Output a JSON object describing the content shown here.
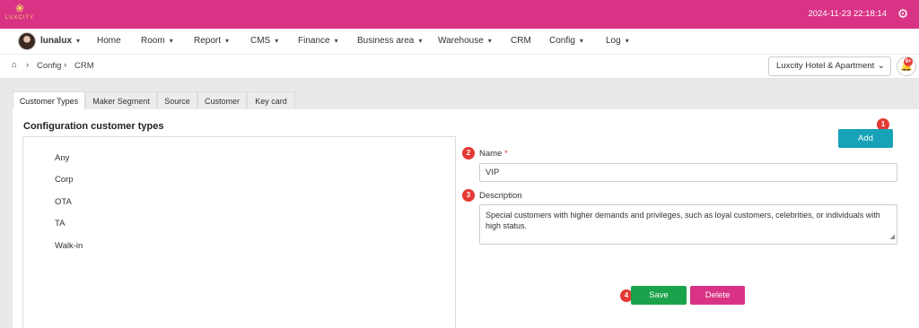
{
  "brand": {
    "logo_text": "LUXCITY"
  },
  "topbar": {
    "datetime": "2024-11-23 22:18:14",
    "settings_icon": "gear-icon"
  },
  "nav": {
    "user": "lunalux",
    "items": [
      {
        "label": "Home",
        "has_menu": false
      },
      {
        "label": "Room",
        "has_menu": true
      },
      {
        "label": "Report",
        "has_menu": true
      },
      {
        "label": "CMS",
        "has_menu": true
      },
      {
        "label": "Finance",
        "has_menu": true
      },
      {
        "label": "Business area",
        "has_menu": true
      },
      {
        "label": "Warehouse",
        "has_menu": true
      },
      {
        "label": "CRM",
        "has_menu": false
      },
      {
        "label": "Config",
        "has_menu": true
      },
      {
        "label": "Log",
        "has_menu": true
      }
    ]
  },
  "breadcrumb": {
    "items": [
      "Config",
      "CRM"
    ]
  },
  "hotel_select": {
    "value": "Luxcity Hotel & Apartment"
  },
  "notifications": {
    "badge": "9+"
  },
  "tabs": [
    "Customer Types",
    "Maker Segment",
    "Source",
    "Customer",
    "Key card"
  ],
  "active_tab": "Customer Types",
  "section": {
    "title": "Configuration customer types"
  },
  "customer_types": [
    "Any",
    "Corp",
    "OTA",
    "TA",
    "Walk-in"
  ],
  "form": {
    "add_label": "Add",
    "name_label": "Name",
    "name_required_mark": "*",
    "name_value": "VIP",
    "description_label": "Description",
    "description_value": "Special customers with higher demands and privileges, such as loyal customers, celebrities, or individuals with high status.",
    "save_label": "Save",
    "delete_label": "Delete"
  },
  "markers": [
    "1",
    "2",
    "3",
    "4"
  ],
  "colors": {
    "brand": "#d83385",
    "add": "#17a2b8",
    "save": "#1aa34a",
    "delete": "#d83385",
    "marker": "#e53935"
  }
}
